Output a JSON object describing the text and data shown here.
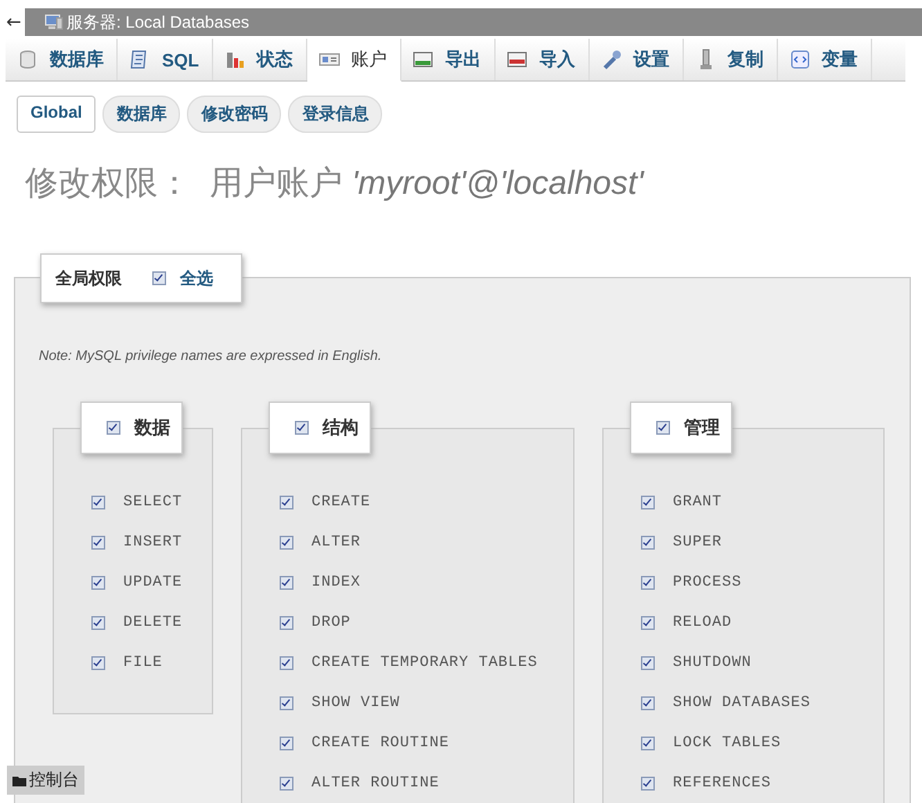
{
  "top_bar": {
    "back": "←",
    "title": "服务器: Local Databases"
  },
  "tabs": [
    {
      "label": "数据库",
      "selected": false
    },
    {
      "label": "SQL",
      "selected": false
    },
    {
      "label": "状态",
      "selected": false
    },
    {
      "label": "账户",
      "selected": true
    },
    {
      "label": "导出",
      "selected": false
    },
    {
      "label": "导入",
      "selected": false
    },
    {
      "label": "设置",
      "selected": false
    },
    {
      "label": "复制",
      "selected": false
    },
    {
      "label": "变量",
      "selected": false
    }
  ],
  "subtabs": [
    {
      "label": "Global",
      "selected": true
    },
    {
      "label": "数据库",
      "selected": false
    },
    {
      "label": "修改密码",
      "selected": false
    },
    {
      "label": "登录信息",
      "selected": false
    }
  ],
  "heading": {
    "prefix": "修改权限：",
    "middle": "用户账户",
    "account": "'myroot'@'localhost'"
  },
  "global": {
    "legend": "全局权限",
    "checked": true,
    "select_all": "全选"
  },
  "note": "Note: MySQL privilege names are expressed in English.",
  "groups": [
    {
      "legend": "数据",
      "checked": true,
      "items": [
        {
          "label": "SELECT",
          "checked": true
        },
        {
          "label": "INSERT",
          "checked": true
        },
        {
          "label": "UPDATE",
          "checked": true
        },
        {
          "label": "DELETE",
          "checked": true
        },
        {
          "label": "FILE",
          "checked": true
        }
      ]
    },
    {
      "legend": "结构",
      "checked": true,
      "items": [
        {
          "label": "CREATE",
          "checked": true
        },
        {
          "label": "ALTER",
          "checked": true
        },
        {
          "label": "INDEX",
          "checked": true
        },
        {
          "label": "DROP",
          "checked": true
        },
        {
          "label": "CREATE TEMPORARY TABLES",
          "checked": true
        },
        {
          "label": "SHOW VIEW",
          "checked": true
        },
        {
          "label": "CREATE ROUTINE",
          "checked": true
        },
        {
          "label": "ALTER ROUTINE",
          "checked": true
        }
      ]
    },
    {
      "legend": "管理",
      "checked": true,
      "items": [
        {
          "label": "GRANT",
          "checked": true
        },
        {
          "label": "SUPER",
          "checked": true
        },
        {
          "label": "PROCESS",
          "checked": true
        },
        {
          "label": "RELOAD",
          "checked": true
        },
        {
          "label": "SHUTDOWN",
          "checked": true
        },
        {
          "label": "SHOW DATABASES",
          "checked": true
        },
        {
          "label": "LOCK TABLES",
          "checked": true
        },
        {
          "label": "REFERENCES",
          "checked": true
        }
      ]
    }
  ],
  "console": {
    "label": "控制台"
  }
}
